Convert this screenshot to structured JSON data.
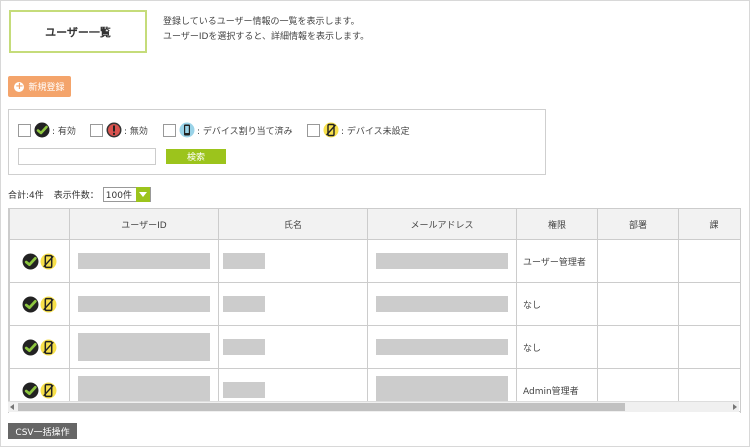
{
  "page": {
    "title": "ユーザー一覧",
    "description_line1": "登録しているユーザー情報の一覧を表示します。",
    "description_line2": "ユーザーIDを選択すると、詳細情報を表示します。"
  },
  "toolbar": {
    "new_button": "新規登録",
    "csv_button": "CSV一括操作"
  },
  "filters": {
    "items": [
      {
        "label": ": 有効",
        "icon": "check-circle-icon"
      },
      {
        "label": ": 無効",
        "icon": "exclamation-circle-icon"
      },
      {
        "label": ": デバイス割り当て済み",
        "icon": "device-assigned-icon"
      },
      {
        "label": ": デバイス未設定",
        "icon": "device-unset-icon"
      }
    ],
    "search_value": "",
    "search_button": "検索"
  },
  "summary": {
    "total": "合計:4件",
    "per_page_label": "表示件数：",
    "per_page_value": "100件"
  },
  "table": {
    "columns": [
      "",
      "ユーザーID",
      "氏名",
      "メールアドレス",
      "権限",
      "部署",
      "課"
    ],
    "rows": [
      {
        "status_icons": [
          "check-circle-icon",
          "device-unset-icon"
        ],
        "role": "ユーザー管理者"
      },
      {
        "status_icons": [
          "check-circle-icon",
          "device-unset-icon"
        ],
        "role": "なし"
      },
      {
        "status_icons": [
          "check-circle-icon",
          "device-unset-icon"
        ],
        "role": "なし"
      },
      {
        "status_icons": [
          "check-circle-icon",
          "device-unset-icon"
        ],
        "role": "Admin管理者"
      }
    ]
  },
  "colors": {
    "accent_green": "#9cc41c",
    "orange": "#f4a46b",
    "title_border": "#c5dc7a",
    "redacted": "#cccccc"
  }
}
